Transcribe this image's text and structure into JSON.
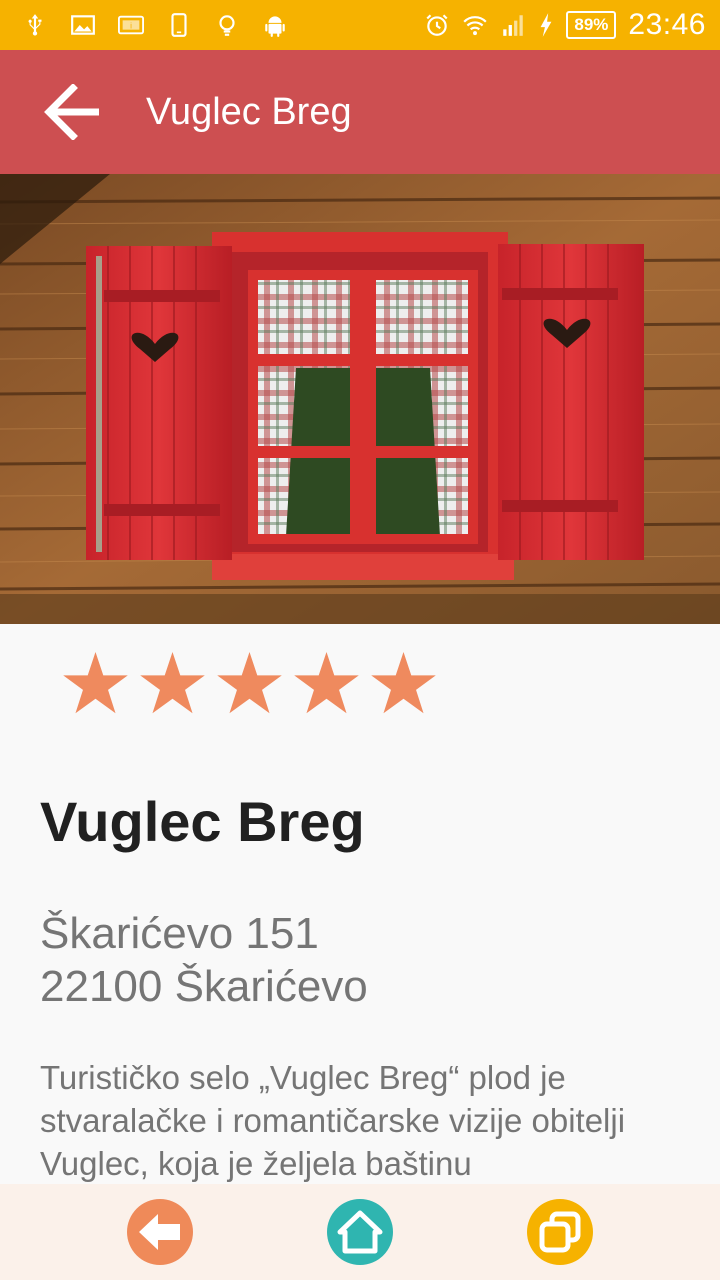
{
  "status_bar": {
    "battery_percent": "89%",
    "time": "23:46",
    "icons": [
      "usb-icon",
      "image-icon",
      "info-card-icon",
      "phone-icon",
      "lightbulb-icon",
      "android-icon",
      "alarm-icon",
      "wifi-icon",
      "signal-icon",
      "charging-icon"
    ]
  },
  "app_bar": {
    "title": "Vuglec Breg",
    "back_icon": "arrow-left-icon"
  },
  "hero": {
    "image_subject": "red-window-with-heart-shutters"
  },
  "rating": {
    "value": 5,
    "max": 5,
    "star_color": "#ef8a5e"
  },
  "details": {
    "name": "Vuglec Breg",
    "address_line1": "Škarićevo 151",
    "address_line2": "22100 Škarićevo",
    "description": "Turističko selo „Vuglec Breg“ plod je stvaralačke i romantičarske vizije obitelji Vuglec, koja je željela baštinu"
  },
  "bottom_nav": {
    "items": [
      {
        "icon": "arrow-back-icon",
        "color": "#ef8a59"
      },
      {
        "icon": "home-icon",
        "color": "#2fb5b0"
      },
      {
        "icon": "windows-icon",
        "color": "#f6b200"
      }
    ]
  },
  "colors": {
    "status_bar": "#f6b200",
    "app_bar": "#cd4f51",
    "background": "#f9f9f9",
    "bottom_nav": "#fbf1ea"
  }
}
